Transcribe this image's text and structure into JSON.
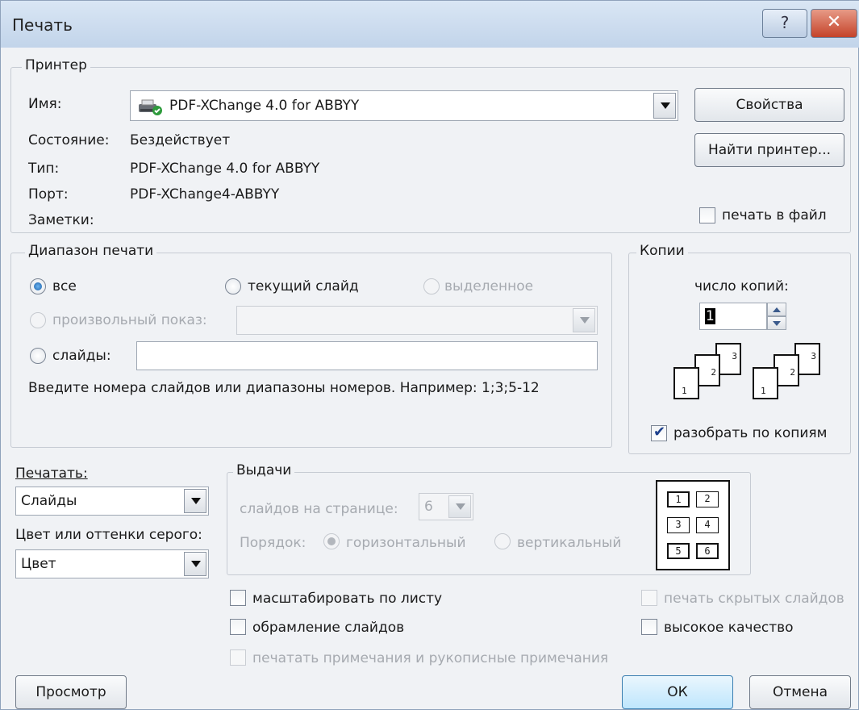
{
  "window": {
    "title": "Печать",
    "help_glyph": "?",
    "close_glyph": "✕"
  },
  "printer": {
    "group_label": "Принтер",
    "name_label": "Имя:",
    "name_value": "PDF-XChange 4.0 for ABBYY",
    "status_label": "Состояние:",
    "status_value": "Бездействует",
    "type_label": "Тип:",
    "type_value": "PDF-XChange 4.0 for ABBYY",
    "port_label": "Порт:",
    "port_value": "PDF-XChange4-ABBYY",
    "notes_label": "Заметки:",
    "properties_button": "Свойства",
    "find_printer_button": "Найти принтер...",
    "print_to_file_label": "печать в файл",
    "print_to_file_checked": false,
    "printer_icon": "printer-icon"
  },
  "range": {
    "group_label": "Диапазон печати",
    "all_label": "все",
    "current_slide_label": "текущий слайд",
    "selection_label": "выделенное",
    "custom_show_label": "произвольный показ:",
    "slides_label": "слайды:",
    "hint": "Введите номера слайдов или диапазоны номеров. Например: 1;3;5-12",
    "selected": "all"
  },
  "copies": {
    "group_label": "Копии",
    "count_label": "число копий:",
    "count_value": "1",
    "collate_label": "разобрать по копиям",
    "collate_checked": true,
    "page_numbers": [
      "1",
      "2",
      "3"
    ]
  },
  "print_what": {
    "label": "Печатать:",
    "value": "Слайды"
  },
  "color": {
    "label": "Цвет или оттенки серого:",
    "value": "Цвет"
  },
  "handouts": {
    "group_label": "Выдачи",
    "slides_per_page_label": "слайдов на странице:",
    "slides_per_page_value": "6",
    "order_label": "Порядок:",
    "horizontal_label": "горизонтальный",
    "vertical_label": "вертикальный",
    "preview_numbers": [
      "1",
      "2",
      "3",
      "4",
      "5",
      "6"
    ]
  },
  "options": {
    "scale_to_fit": "масштабировать по листу",
    "frame_slides": "обрамление слайдов",
    "print_comments": "печатать примечания и рукописные примечания",
    "print_hidden": "печать скрытых слайдов",
    "high_quality": "высокое качество"
  },
  "buttons": {
    "preview": "Просмотр",
    "ok": "ОК",
    "cancel": "Отмена"
  },
  "colors": {
    "accent": "#1a5fa8",
    "close_button": "#c4432a",
    "disabled_text": "#a6aab0"
  }
}
